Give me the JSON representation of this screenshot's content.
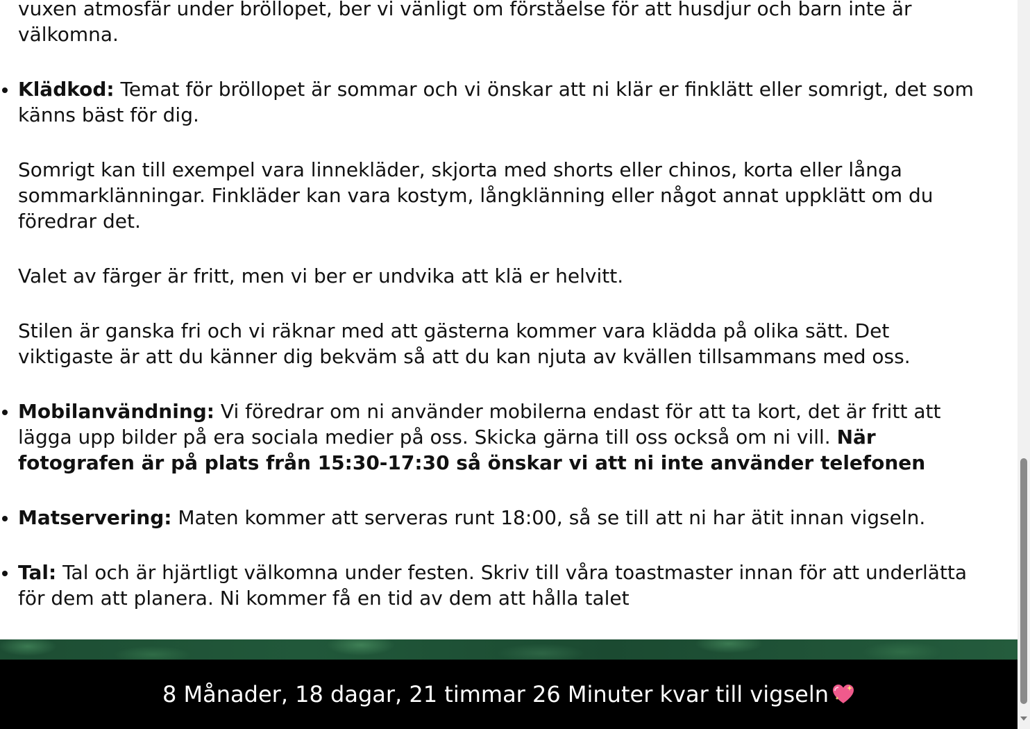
{
  "content": {
    "intro_tail": "vuxen atmosfär under bröllopet, ber vi vänligt om förståelse för att husdjur och barn inte är välkomna.",
    "dress_code": {
      "label": "Klädkod:",
      "text": " Temat för bröllopet är sommar och vi önskar att ni klär er finklätt eller somrigt, det som känns bäst för dig.",
      "para2": "Somrigt kan till exempel vara linnekläder, skjorta med shorts eller chinos, korta eller långa sommarklänningar. Finkläder kan vara kostym, långklänning eller något annat uppklätt om du föredrar det.",
      "para3": "Valet av färger är fritt, men vi ber er undvika att klä er helvitt.",
      "para4": "Stilen är ganska fri och vi räknar med att gästerna kommer vara klädda på olika sätt. Det viktigaste är att du känner dig bekväm så att du kan njuta av kvällen tillsammans med oss."
    },
    "mobile": {
      "label": "Mobilanvändning:",
      "text": " Vi föredrar om ni använder mobilerna endast för att ta kort, det är fritt att lägga upp bilder på era sociala medier på oss. Skicka gärna till oss också om ni vill. ",
      "bold_tail": "När fotografen är på plats från 15:30-17:30 så önskar vi att ni inte använder telefonen"
    },
    "food": {
      "label": "Matservering:",
      "text": " Maten kommer att serveras runt 18:00, så se till att ni har ätit innan vigseln."
    },
    "speeches": {
      "label": "Tal:",
      "text": " Tal och är hjärtligt välkomna under festen. Skriv till våra toastmaster innan för att underlätta för dem att planera. Ni kommer få en tid av dem att hålla talet"
    }
  },
  "footer": {
    "countdown": "8 Månader, 18 dagar, 21 timmar 26 Minuter kvar till vigseln",
    "icon": "sparkling-heart-icon",
    "background": "#000000",
    "text_color": "#ffffff"
  }
}
